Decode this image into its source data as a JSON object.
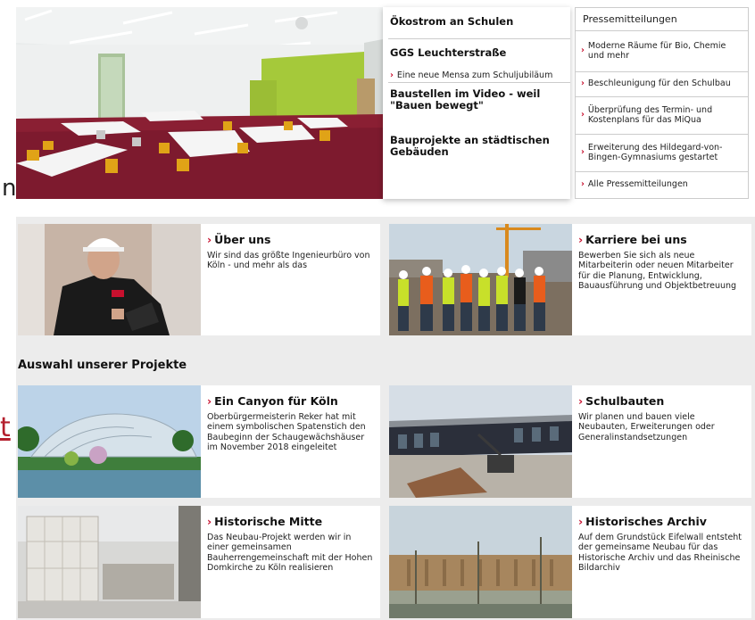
{
  "edge": {
    "left_letter": "n",
    "left_link_letter": "t"
  },
  "hero": {
    "nav": [
      {
        "label": "Ökostrom an Schulen"
      },
      {
        "label": "GGS Leuchterstraße"
      },
      {
        "label": "Eine neue Mensa zum Schuljubiläum"
      },
      {
        "label": "Baustellen im Video - weil \"Bauen bewegt\""
      },
      {
        "label": "Bauprojekte an städtischen Gebäuden"
      }
    ]
  },
  "press": {
    "heading": "Pressemitteilungen",
    "items": [
      "Moderne Räume für Bio, Chemie und mehr",
      "Beschleunigung für den Schulbau",
      "Überprüfung des Termin- und Kostenplans für das MiQua",
      "Erweiterung des Hildegard-von-Bingen-Gymnasiums gestartet",
      "Alle Pressemitteilungen"
    ]
  },
  "cards_top": [
    {
      "title": "Über uns",
      "desc": "Wir sind das größte Ingenieurbüro von Köln - und mehr als das"
    },
    {
      "title": "Karriere bei uns",
      "desc": "Bewerben Sie sich als neue Mitarbeiterin oder neuen Mitarbeiter für die Planung, Entwicklung, Bauausführung und Objektbetreuung"
    }
  ],
  "section": {
    "title": "Auswahl unserer Projekte"
  },
  "projects": [
    {
      "title": "Ein Canyon für Köln",
      "desc": "Oberbürgermeisterin Reker hat mit einem symbolischen Spatenstich den Baubeginn der Schaugewächshäuser im November 2018 eingeleitet"
    },
    {
      "title": "Schulbauten",
      "desc": "Wir planen und bauen viele Neubauten, Erweiterungen oder Generalinstandsetzungen"
    },
    {
      "title": "Historische Mitte",
      "desc": "Das Neubau-Projekt werden wir in einer gemeinsamen Bauherrengemeinschaft mit der Hohen Domkirche zu Köln realisieren"
    },
    {
      "title": "Historisches Archiv",
      "desc": "Auf dem Grundstück Eifelwall entsteht der gemeinsame Neubau für das Historische Archiv und das Rheinische Bildarchiv"
    }
  ],
  "colors": {
    "accent": "#c8102e",
    "gray_bg": "#ececec"
  }
}
